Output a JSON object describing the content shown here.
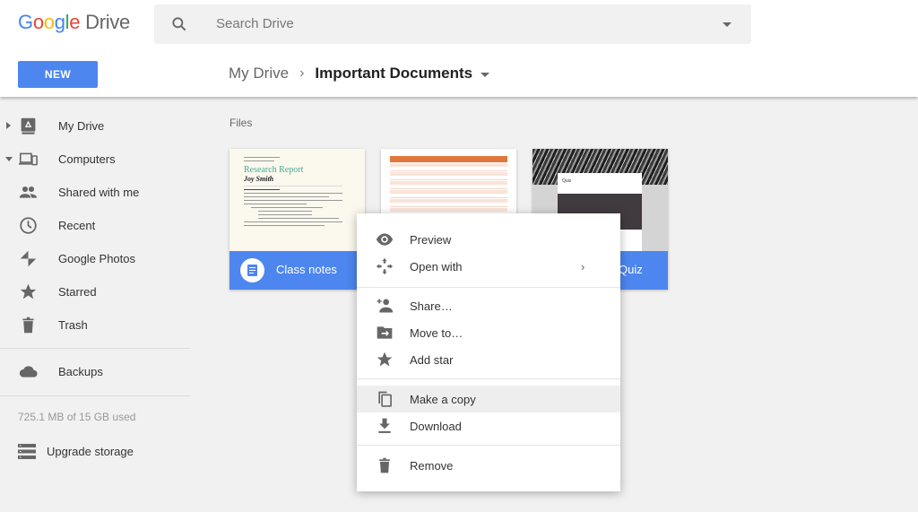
{
  "app": {
    "logo_letters": [
      "G",
      "o",
      "o",
      "g",
      "l",
      "e"
    ],
    "logo_product": "Drive",
    "brand_colors": {
      "blue": "#4285f4",
      "red": "#ea4335",
      "yellow": "#fbbc05",
      "green": "#34a853",
      "accent": "#4d86ee"
    }
  },
  "search": {
    "placeholder": "Search Drive",
    "icon": "search-icon"
  },
  "toolbar": {
    "new_label": "NEW"
  },
  "breadcrumb": {
    "root": "My Drive",
    "separator": "›",
    "current": "Important Documents"
  },
  "sidebar": {
    "items": [
      {
        "label": "My Drive",
        "icon": "drive-icon",
        "expander": "collapsed"
      },
      {
        "label": "Computers",
        "icon": "computers-icon",
        "expander": "expanded"
      },
      {
        "label": "Shared with me",
        "icon": "people-icon"
      },
      {
        "label": "Recent",
        "icon": "clock-icon"
      },
      {
        "label": "Google Photos",
        "icon": "pinwheel-icon"
      },
      {
        "label": "Starred",
        "icon": "star-icon"
      },
      {
        "label": "Trash",
        "icon": "trash-icon"
      },
      {
        "label": "Backups",
        "icon": "cloud-icon"
      }
    ],
    "storage": "725.1 MB of 15 GB used",
    "upgrade": "Upgrade storage"
  },
  "main": {
    "section_label": "Files",
    "files": [
      {
        "name": "Class notes",
        "type": "document",
        "preview_title": "Research Report",
        "preview_author": "Joy Smith"
      },
      {
        "name": "",
        "type": "spreadsheet"
      },
      {
        "name": "Quiz",
        "type": "form",
        "preview_title": "Quiz"
      }
    ]
  },
  "context_menu": {
    "items": [
      {
        "label": "Preview",
        "icon": "eye-icon"
      },
      {
        "label": "Open with",
        "icon": "open-with-icon",
        "submenu": "›"
      },
      {
        "label": "Share…",
        "icon": "add-person-icon"
      },
      {
        "label": "Move to…",
        "icon": "move-folder-icon"
      },
      {
        "label": "Add star",
        "icon": "star-icon"
      },
      {
        "label": "Make a copy",
        "icon": "copy-icon",
        "highlighted": true
      },
      {
        "label": "Download",
        "icon": "download-icon"
      },
      {
        "label": "Remove",
        "icon": "trash-icon"
      }
    ]
  }
}
